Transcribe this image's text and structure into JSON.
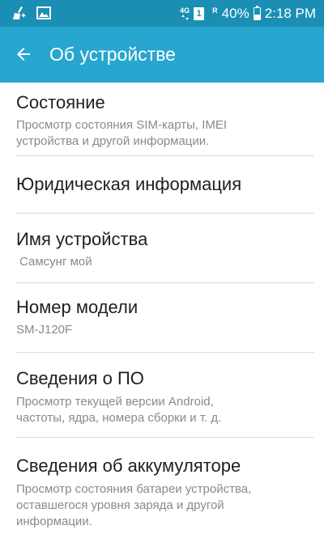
{
  "status_bar": {
    "network": "4G",
    "sim": "1",
    "roaming": "R",
    "battery_percent": "40%",
    "battery_level": 0.4,
    "time": "2:18 PM"
  },
  "app_bar": {
    "title": "Об устройстве",
    "background": "#27a6cf"
  },
  "items": [
    {
      "title": "Состояние",
      "subtitle": "Просмотр состояния SIM-карты, IMEI\nустройства и другой информации."
    },
    {
      "title": "Юридическая информация"
    },
    {
      "title": "Имя устройства",
      "subtitle": "Самсунг мой"
    },
    {
      "title": "Номер модели",
      "subtitle": "SM-J120F"
    },
    {
      "title": "Сведения о ПО",
      "subtitle": "Просмотр текущей версии Android,\nчастоты, ядра, номера сборки и т. д."
    },
    {
      "title": "Сведения об аккумуляторе",
      "subtitle": "Просмотр состояния батареи устройства,\nоставшегося уровня заряда и другой\nинформации."
    }
  ]
}
